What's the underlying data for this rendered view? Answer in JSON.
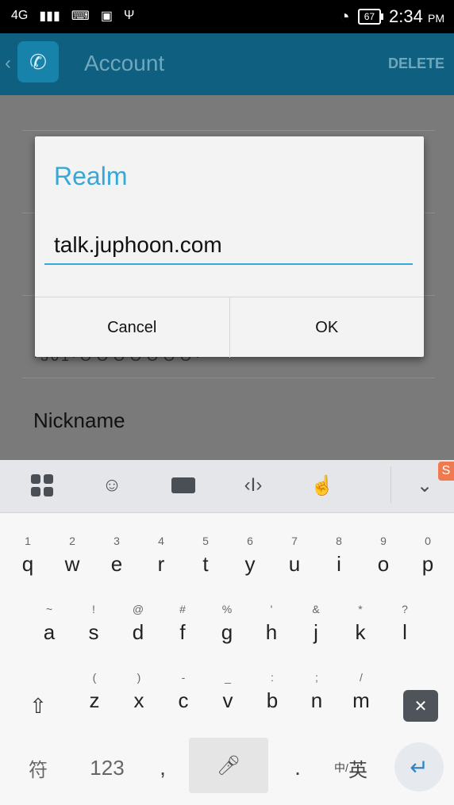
{
  "status_bar": {
    "signal": "4G",
    "battery": "67",
    "time": "2:34",
    "ampm": "PM"
  },
  "app_bar": {
    "title": "Account",
    "delete_label": "DELETE"
  },
  "background": {
    "nickname_label": "Nickname",
    "partial_value": "·301·ＯＯＯＯＯＯＯ·"
  },
  "dialog": {
    "title": "Realm",
    "input_value": "talk.juphoon.com",
    "cancel_label": "Cancel",
    "ok_label": "OK"
  },
  "keyboard": {
    "row1": [
      {
        "sub": "1",
        "main": "q"
      },
      {
        "sub": "2",
        "main": "w"
      },
      {
        "sub": "3",
        "main": "e"
      },
      {
        "sub": "4",
        "main": "r"
      },
      {
        "sub": "5",
        "main": "t"
      },
      {
        "sub": "6",
        "main": "y"
      },
      {
        "sub": "7",
        "main": "u"
      },
      {
        "sub": "8",
        "main": "i"
      },
      {
        "sub": "9",
        "main": "o"
      },
      {
        "sub": "0",
        "main": "p"
      }
    ],
    "row2": [
      {
        "sub": "~",
        "main": "a"
      },
      {
        "sub": "!",
        "main": "s"
      },
      {
        "sub": "@",
        "main": "d"
      },
      {
        "sub": "#",
        "main": "f"
      },
      {
        "sub": "%",
        "main": "g"
      },
      {
        "sub": "'",
        "main": "h"
      },
      {
        "sub": "&",
        "main": "j"
      },
      {
        "sub": "*",
        "main": "k"
      },
      {
        "sub": "?",
        "main": "l"
      }
    ],
    "row3": [
      {
        "sub": "(",
        "main": "z"
      },
      {
        "sub": ")",
        "main": "x"
      },
      {
        "sub": "-",
        "main": "c"
      },
      {
        "sub": "_",
        "main": "v"
      },
      {
        "sub": ":",
        "main": "b"
      },
      {
        "sub": ";",
        "main": "n"
      },
      {
        "sub": "/",
        "main": "m"
      }
    ],
    "symbols_label": "符",
    "numbers_label": "123",
    "comma_label": ",",
    "period_label": ".",
    "language_label_small": "中/",
    "language_label_big": "英"
  }
}
